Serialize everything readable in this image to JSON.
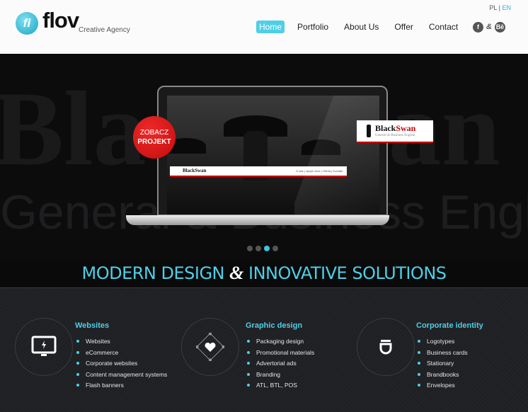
{
  "header": {
    "logo_mark": "fl",
    "logo_text": "flov",
    "logo_tagline": "Creative Agency",
    "lang": {
      "pl": "PL",
      "sep": "|",
      "en": "EN"
    },
    "nav": [
      {
        "label": "Home",
        "active": true
      },
      {
        "label": "Portfolio"
      },
      {
        "label": "About Us"
      },
      {
        "label": "Offer"
      },
      {
        "label": "Contact"
      }
    ],
    "social": [
      {
        "icon": "facebook-icon",
        "label": "f"
      },
      {
        "icon": "ampersand-icon",
        "label": "&"
      },
      {
        "icon": "behance-icon",
        "label": "Bē"
      }
    ]
  },
  "slider": {
    "watermark_title": "BlackSwan",
    "watermark_sub": "General & Business English",
    "badge_line1": "ZOBACZ",
    "badge_line2": "PROJEKT",
    "ribbon_title_black": "Black",
    "ribbon_title_red": "Swan",
    "ribbon_sub": "General & Business English",
    "mini_nav": "O nas | Języki obce | Oferta | Kontakt",
    "slides": 4,
    "active_slide": 3,
    "accent": "#3fc4df",
    "red": "#d41414"
  },
  "band": {
    "part1": "MODERN DESIGN ",
    "amp": "&",
    "part2": " INNOVATIVE SOLUTIONS"
  },
  "services": [
    {
      "icon": "monitor-icon",
      "title": "Websites",
      "items": [
        "Websites",
        "eCommerce",
        "Corporate websites",
        "Content management systems",
        "Flash banners"
      ]
    },
    {
      "icon": "heart-diamond-icon",
      "title": "Graphic design",
      "items": [
        "Packaging design",
        "Promotional materials",
        "Advertorial ads",
        "Branding",
        "ATL, BTL, POS"
      ]
    },
    {
      "icon": "identity-icon",
      "title": "Corporate identity",
      "items": [
        "Logotypes",
        "Business cards",
        "Stationary",
        "Brandbooks",
        "Envelopes"
      ]
    }
  ]
}
